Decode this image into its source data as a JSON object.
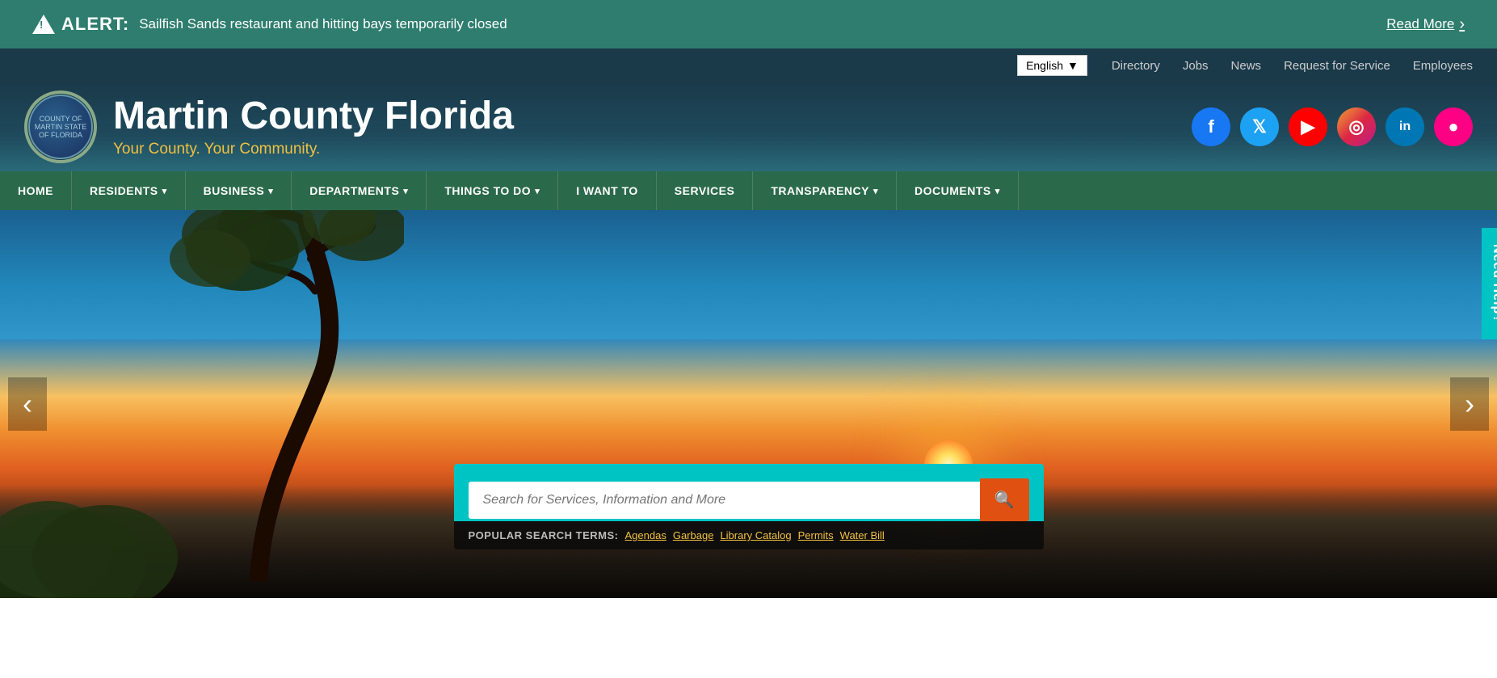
{
  "alert": {
    "icon_label": "alert-triangle",
    "label": "ALERT:",
    "message": "Sailfish Sands restaurant and hitting bays temporarily closed",
    "readmore": "Read More"
  },
  "utility": {
    "language": "English",
    "language_arrow": "▼",
    "links": [
      {
        "label": "Directory",
        "id": "directory"
      },
      {
        "label": "Jobs",
        "id": "jobs"
      },
      {
        "label": "News",
        "id": "news"
      },
      {
        "label": "Request for Service",
        "id": "request-for-service"
      },
      {
        "label": "Employees",
        "id": "employees"
      }
    ]
  },
  "header": {
    "seal_text": "COUNTY OF MARTIN STATE OF FLORIDA",
    "site_title": "Martin County Florida",
    "tagline": "Your County. Your Community.",
    "social": [
      {
        "id": "facebook",
        "symbol": "f",
        "class": "si-facebook",
        "label": "facebook-icon"
      },
      {
        "id": "twitter",
        "symbol": "t",
        "class": "si-twitter",
        "label": "twitter-icon"
      },
      {
        "id": "youtube",
        "symbol": "▶",
        "class": "si-youtube",
        "label": "youtube-icon"
      },
      {
        "id": "instagram",
        "symbol": "◎",
        "class": "si-instagram",
        "label": "instagram-icon"
      },
      {
        "id": "linkedin",
        "symbol": "in",
        "class": "si-linkedin",
        "label": "linkedin-icon"
      },
      {
        "id": "flickr",
        "symbol": "●",
        "class": "si-flickr",
        "label": "flickr-icon"
      }
    ]
  },
  "nav": {
    "items": [
      {
        "label": "HOME",
        "has_arrow": false,
        "id": "home"
      },
      {
        "label": "RESIDENTS",
        "has_arrow": true,
        "id": "residents"
      },
      {
        "label": "BUSINESS",
        "has_arrow": true,
        "id": "business"
      },
      {
        "label": "DEPARTMENTS",
        "has_arrow": true,
        "id": "departments"
      },
      {
        "label": "THINGS TO DO",
        "has_arrow": true,
        "id": "things-to-do"
      },
      {
        "label": "I WANT TO",
        "has_arrow": false,
        "id": "i-want-to"
      },
      {
        "label": "SERVICES",
        "has_arrow": false,
        "id": "services"
      },
      {
        "label": "TRANSPARENCY",
        "has_arrow": true,
        "id": "transparency"
      },
      {
        "label": "DOCUMENTS",
        "has_arrow": true,
        "id": "documents"
      }
    ]
  },
  "hero": {
    "prev_label": "‹",
    "next_label": "›"
  },
  "search": {
    "placeholder": "Search for Services, Information and More",
    "button_icon": "🔍",
    "popular_label": "POPULAR SEARCH TERMS:",
    "popular_links": [
      {
        "label": "Agendas",
        "id": "agendas"
      },
      {
        "label": "Garbage",
        "id": "garbage"
      },
      {
        "label": "Library Catalog",
        "id": "library-catalog"
      },
      {
        "label": "Permits",
        "id": "permits"
      },
      {
        "label": "Water Bill",
        "id": "water-bill"
      }
    ]
  },
  "need_help": {
    "label": "Need Help?"
  }
}
